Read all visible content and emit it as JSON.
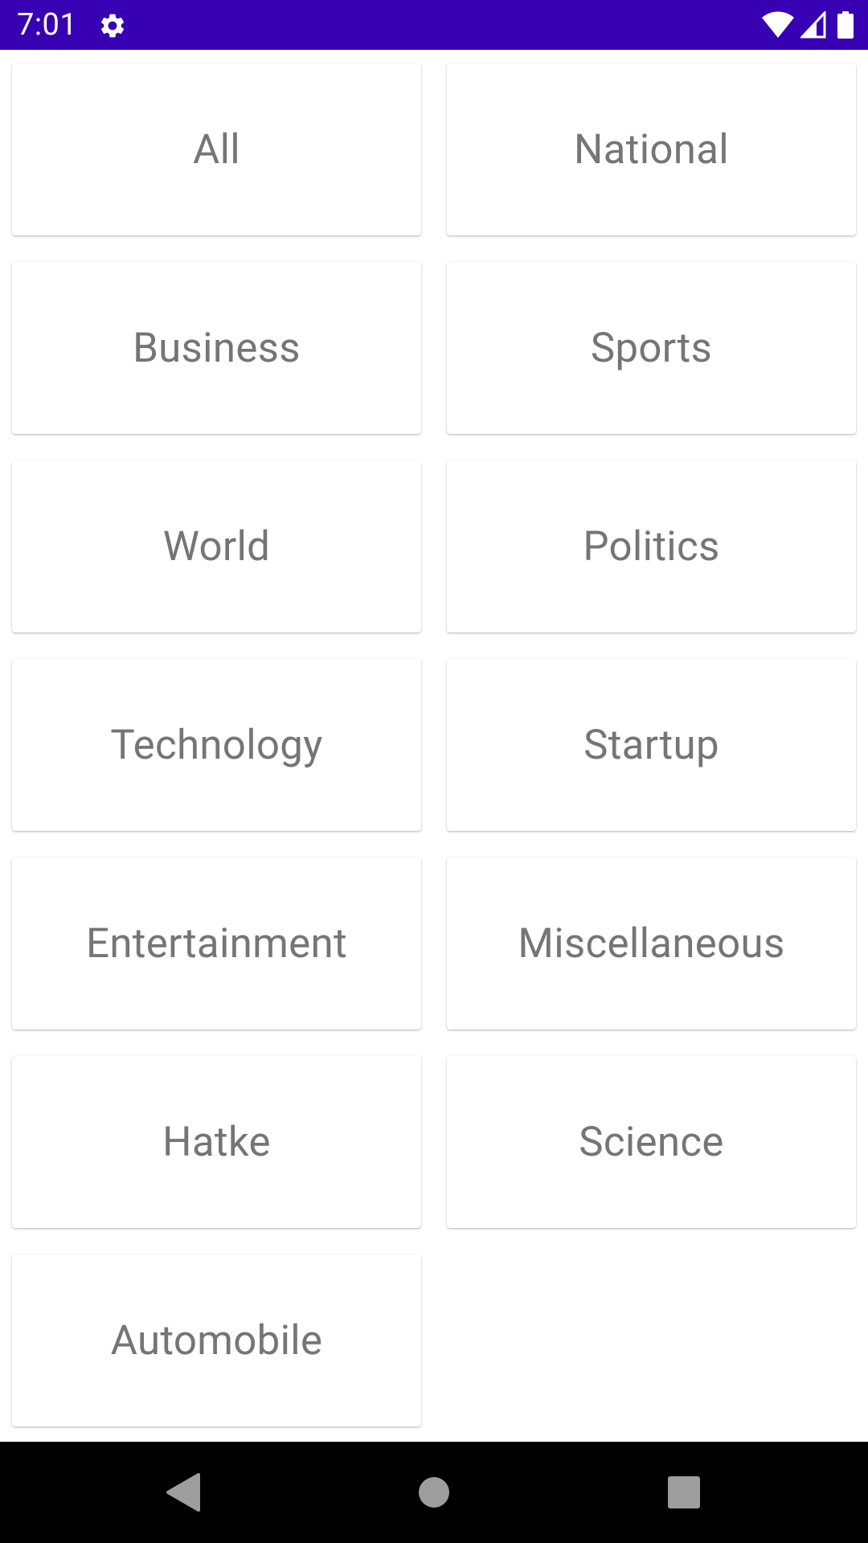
{
  "status_bar": {
    "time": "7:01",
    "background": "#3700b3",
    "icons": [
      "gear-icon",
      "wifi-icon",
      "signal-icon",
      "battery-icon"
    ]
  },
  "categories": [
    {
      "label": "All"
    },
    {
      "label": "National"
    },
    {
      "label": "Business"
    },
    {
      "label": "Sports"
    },
    {
      "label": "World"
    },
    {
      "label": "Politics"
    },
    {
      "label": "Technology"
    },
    {
      "label": "Startup"
    },
    {
      "label": "Entertainment"
    },
    {
      "label": "Miscellaneous"
    },
    {
      "label": "Hatke"
    },
    {
      "label": "Science"
    },
    {
      "label": "Automobile"
    }
  ],
  "colors": {
    "label_text": "#757575",
    "card_background": "#ffffff",
    "nav_bar": "#000000",
    "nav_icons": "#9e9e9e"
  },
  "nav_bar": {
    "buttons": [
      "back-icon",
      "home-icon",
      "recents-icon"
    ]
  }
}
